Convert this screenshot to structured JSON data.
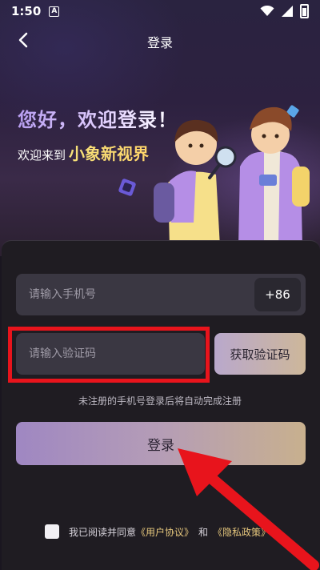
{
  "status_bar": {
    "time": "1:50",
    "app_badge": "A"
  },
  "nav": {
    "title": "登录"
  },
  "hero": {
    "greeting": "您好，欢迎登录！",
    "welcome_prefix": "欢迎来到",
    "brand": "小象新视界"
  },
  "form": {
    "phone_placeholder": "请输入手机号",
    "country_code": "+86",
    "code_placeholder": "请输入验证码",
    "get_code_label": "获取验证码",
    "hint": "未注册的手机号登录后将自动完成注册",
    "login_label": "登录"
  },
  "agreement": {
    "prefix": "我已阅读并同意",
    "user_agreement": "《用户协议》",
    "and": "和",
    "privacy_policy": "《隐私政策》",
    "checked": false
  },
  "colors": {
    "highlight": "#e8141c",
    "accent_gold": "#e6c77d",
    "accent_purple": "#b79df0"
  }
}
